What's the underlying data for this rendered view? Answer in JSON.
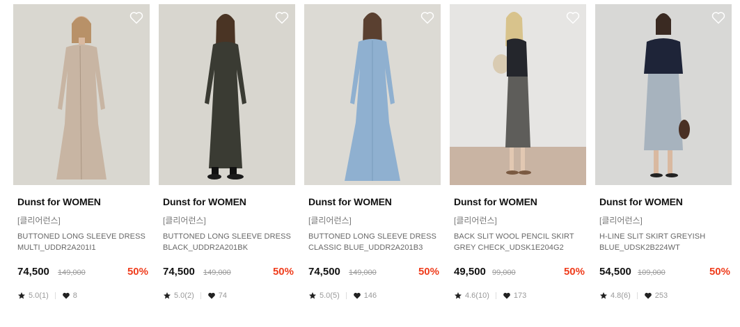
{
  "products": [
    {
      "brand": "Dunst for WOMEN",
      "line": "[클리어런스]",
      "name": "BUTTONED LONG SLEEVE DRESS MULTI_UDDR2A201I1",
      "price": "74,500",
      "original_price": "149,000",
      "discount": "50%",
      "rating": "5.0(1)",
      "likes": "8",
      "bg_color": "#d9d7d0",
      "outfit_color": "#c8b5a3"
    },
    {
      "brand": "Dunst for WOMEN",
      "line": "[클리어런스]",
      "name": "BUTTONED LONG SLEEVE DRESS BLACK_UDDR2A201BK",
      "price": "74,500",
      "original_price": "149,000",
      "discount": "50%",
      "rating": "5.0(2)",
      "likes": "74",
      "bg_color": "#d8d6cf",
      "outfit_color": "#3a3b33"
    },
    {
      "brand": "Dunst for WOMEN",
      "line": "[클리어런스]",
      "name": "BUTTONED LONG SLEEVE DRESS CLASSIC BLUE_UDDR2A201B3",
      "price": "74,500",
      "original_price": "149,000",
      "discount": "50%",
      "rating": "5.0(5)",
      "likes": "146",
      "bg_color": "#dcdad4",
      "outfit_color": "#8fb0d0"
    },
    {
      "brand": "Dunst for WOMEN",
      "line": "[클리어런스]",
      "name": "BACK SLIT WOOL PENCIL SKIRT GREY CHECK_UDSK1E204G2",
      "price": "49,500",
      "original_price": "99,000",
      "discount": "50%",
      "rating": "4.6(10)",
      "likes": "173",
      "bg_color": "#e6e5e3",
      "outfit_color": "#5e5d5a"
    },
    {
      "brand": "Dunst for WOMEN",
      "line": "[클리어런스]",
      "name": "H-LINE SLIT SKIRT GREYISH BLUE_UDSK2B224WT",
      "price": "54,500",
      "original_price": "109,000",
      "discount": "50%",
      "rating": "4.8(6)",
      "likes": "253",
      "bg_color": "#d8d8d6",
      "outfit_color": "#a7b3be"
    }
  ],
  "colors": {
    "discount": "#ef3d1d",
    "brand": "#111111",
    "muted": "#999999"
  },
  "icons": {
    "wishlist": "heart-outline-icon",
    "rating": "star-icon",
    "likes": "heart-filled-icon"
  }
}
